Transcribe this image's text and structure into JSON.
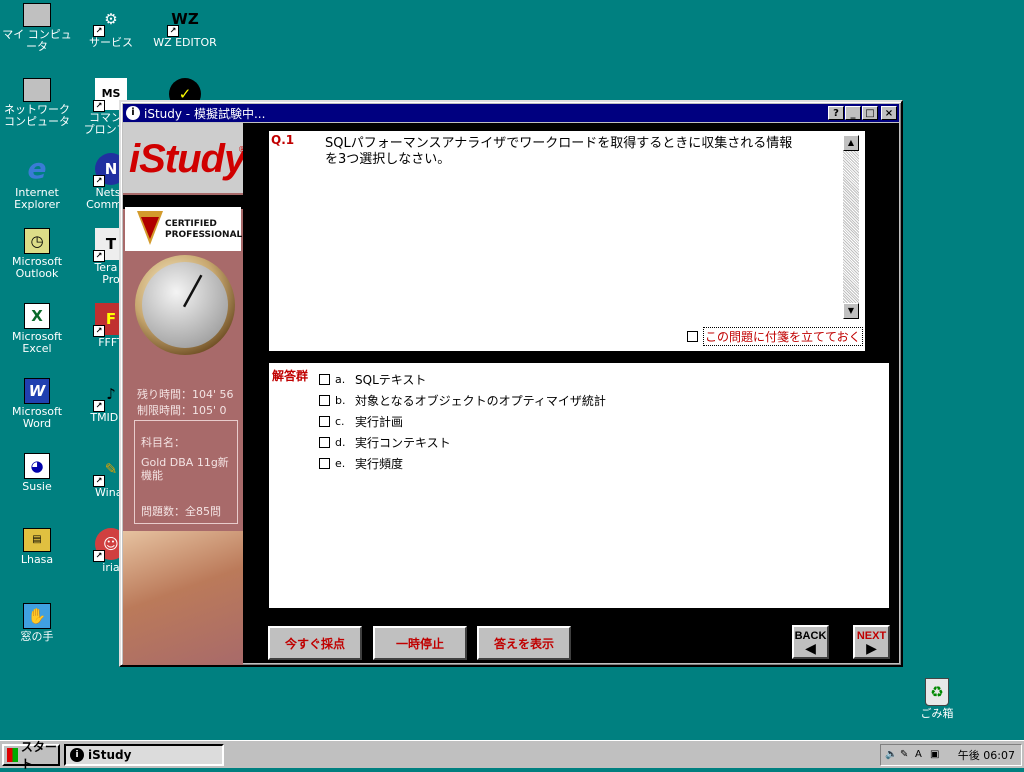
{
  "desktop": {
    "icons": [
      {
        "label": "マイ コンピュータ"
      },
      {
        "label": "サービス"
      },
      {
        "label": "WZ EDITOR"
      },
      {
        "label": "ネットワーク\nコンピュータ"
      },
      {
        "label": "コマンド\nプロンプト"
      },
      {
        "label": "Internet\nExplorer"
      },
      {
        "label": "Netsc\nCommun"
      },
      {
        "label": "Microsoft\nOutlook"
      },
      {
        "label": "Tera T\nPro"
      },
      {
        "label": "Microsoft\nExcel"
      },
      {
        "label": "FFFT"
      },
      {
        "label": "Microsoft\nWord"
      },
      {
        "label": "TMIDI P"
      },
      {
        "label": "Susie"
      },
      {
        "label": "Winar"
      },
      {
        "label": "Lhasa"
      },
      {
        "label": "iria"
      },
      {
        "label": "窓の手"
      },
      {
        "label": "ごみ箱"
      }
    ]
  },
  "window": {
    "title": "iStudy - 模擬試験中...",
    "buttons": {
      "help": "?",
      "minimize": "_",
      "maximize": "□",
      "close": "×"
    }
  },
  "left_panel": {
    "logo": "iStudy",
    "logo_reg": "®",
    "cert_line1": "CERTIFIED",
    "cert_line2": "PROFESSIONAL",
    "remaining_time": "残り時間：104' 56",
    "time_limit": "制限時間：105' 0",
    "subject_label": "科目名：",
    "subject_value": "Gold DBA 11g新機能",
    "question_count": "問題数：全85問",
    "dial_fraction": 0.08
  },
  "question": {
    "number": "Q.1",
    "text": "SQLパフォーマンスアナライザでワークロードを取得するときに収集される情報を3つ選択しなさい。",
    "flag_label": "この問題に付箋を立てておく"
  },
  "answers": {
    "heading": "解答群",
    "options": [
      {
        "letter": "a.",
        "text": "SQLテキスト"
      },
      {
        "letter": "b.",
        "text": "対象となるオブジェクトのオプティマイザ統計"
      },
      {
        "letter": "c.",
        "text": "実行計画"
      },
      {
        "letter": "d.",
        "text": "実行コンテキスト"
      },
      {
        "letter": "e.",
        "text": "実行頻度"
      }
    ]
  },
  "controls": {
    "grade_now": "今すぐ採点",
    "pause": "一時停止",
    "show_answer": "答えを表示",
    "back": "BACK",
    "next": "NEXT"
  },
  "taskbar": {
    "start": "スタート",
    "task": "iStudy",
    "clock": "午後 06:07"
  },
  "colors": {
    "desktop": "#008080",
    "accent_red": "#c00000",
    "titlebar": "#000080",
    "panel": "#a86a6a"
  }
}
